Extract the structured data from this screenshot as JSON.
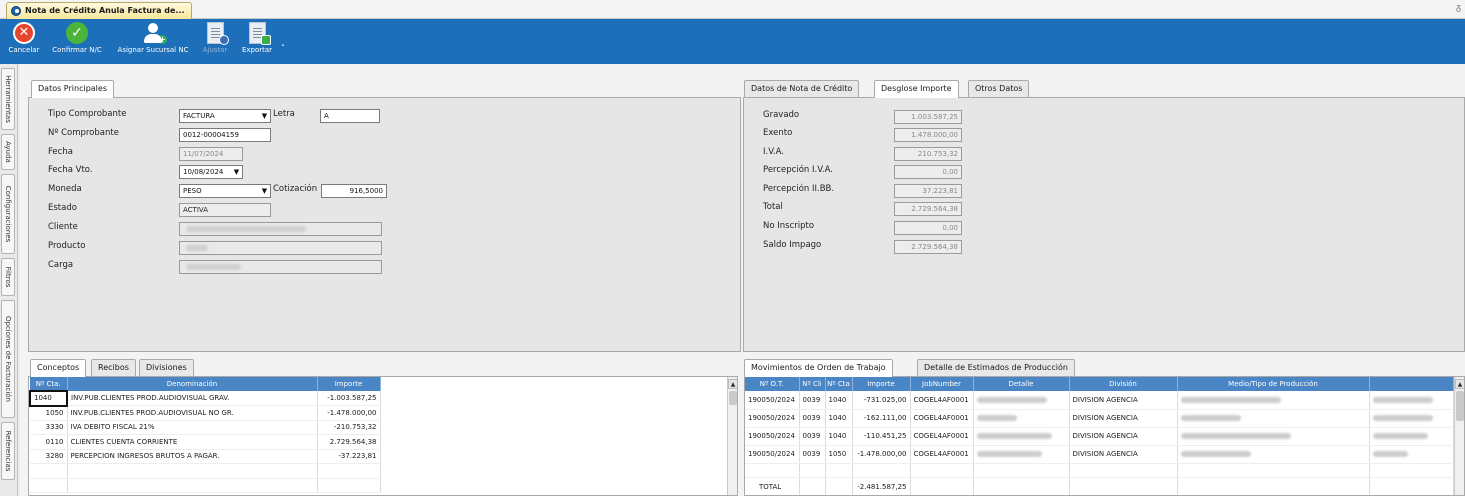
{
  "window": {
    "tab_title": "Nota de Crédito Anula Factura de...",
    "pin": "ᵹ"
  },
  "toolbar": {
    "cancel": "Cancelar",
    "confirm": "Confirmar N/C",
    "assign": "Asignar Sucursal NC",
    "adjust": "Ajustar",
    "export": "Exportar",
    "more": "."
  },
  "left_tabs": [
    "Herramientas",
    "Ayuda",
    "Configuraciones",
    "Filtros",
    "Opciones de Facturación",
    "Referencias"
  ],
  "datos_principales": {
    "tab": "Datos Principales",
    "tipo_comprobante_label": "Tipo Comprobante",
    "tipo_comprobante": "FACTURA",
    "letra_label": "Letra",
    "letra": "A",
    "nro_comprobante_label": "Nº Comprobante",
    "nro_comprobante": "0012-00004159",
    "fecha_label": "Fecha",
    "fecha": "11/07/2024",
    "fecha_vto_label": "Fecha Vto.",
    "fecha_vto": "10/08/2024",
    "moneda_label": "Moneda",
    "moneda": "PESO",
    "cotizacion_label": "Cotización",
    "cotizacion": "916,5000",
    "estado_label": "Estado",
    "estado": "ACTIVA",
    "cliente_label": "Cliente",
    "producto_label": "Producto",
    "carga_label": "Carga"
  },
  "nota_credito": {
    "tabs": [
      "Datos de Nota de Crédito",
      "Desglose Importe",
      "Otros Datos"
    ],
    "rows": [
      {
        "label": "Gravado",
        "value": "1.003.587,25"
      },
      {
        "label": "Exento",
        "value": "1.478.000,00"
      },
      {
        "label": "I.V.A.",
        "value": "210.753,32"
      },
      {
        "label": "Percepción I.V.A.",
        "value": "0,00"
      },
      {
        "label": "Percepción II.BB.",
        "value": "37.223,81"
      },
      {
        "label": "Total",
        "value": "2.729.564,38"
      },
      {
        "label": "No Inscripto",
        "value": "0,00"
      },
      {
        "label": "Saldo Impago",
        "value": "2.729.564,38"
      }
    ]
  },
  "conceptos": {
    "tabs": [
      "Conceptos",
      "Recibos",
      "Divisiones"
    ],
    "columns": [
      "Nº Cta.",
      "Denominación",
      "Importe"
    ],
    "rows": [
      [
        "1040",
        "INV.PUB.CLIENTES PROD.AUDIOVISUAL GRAV.",
        "-1.003.587,25"
      ],
      [
        "1050",
        "INV.PUB.CLIENTES PROD.AUDIOVISUAL NO GR.",
        "-1.478.000,00"
      ],
      [
        "3330",
        "IVA DEBITO FISCAL 21%",
        "-210.753,32"
      ],
      [
        "0110",
        "CLIENTES CUENTA CORRIENTE",
        "2.729.564,38"
      ],
      [
        "3280",
        "PERCEPCION INGRESOS BRUTOS A PAGAR.",
        "-37.223,81"
      ]
    ]
  },
  "movimientos": {
    "tabs": [
      "Movimientos de Orden de Trabajo",
      "Detalle de Estimados de Producción"
    ],
    "columns": [
      "Nº O.T.",
      "Nº Cli",
      "Nº Cta",
      "Importe",
      "JobNumber",
      "Detalle",
      "División",
      "Medio/Tipo de Producción",
      ""
    ],
    "rows": [
      [
        "190050/2024",
        "0039",
        "1040",
        "-731.025,00",
        "COGEL4AF0001",
        "",
        "DIVISION AGENCIA",
        "",
        ""
      ],
      [
        "190050/2024",
        "0039",
        "1040",
        "-162.111,00",
        "COGEL4AF0001",
        "",
        "DIVISION AGENCIA",
        "",
        ""
      ],
      [
        "190050/2024",
        "0039",
        "1040",
        "-110.451,25",
        "COGEL4AF0001",
        "",
        "DIVISION AGENCIA",
        "",
        ""
      ],
      [
        "190050/2024",
        "0039",
        "1050",
        "-1.478.000,00",
        "COGEL4AF0001",
        "",
        "DIVISION AGENCIA",
        "",
        ""
      ]
    ],
    "total_label": "TOTAL",
    "total_value": "-2.481.587,25"
  }
}
